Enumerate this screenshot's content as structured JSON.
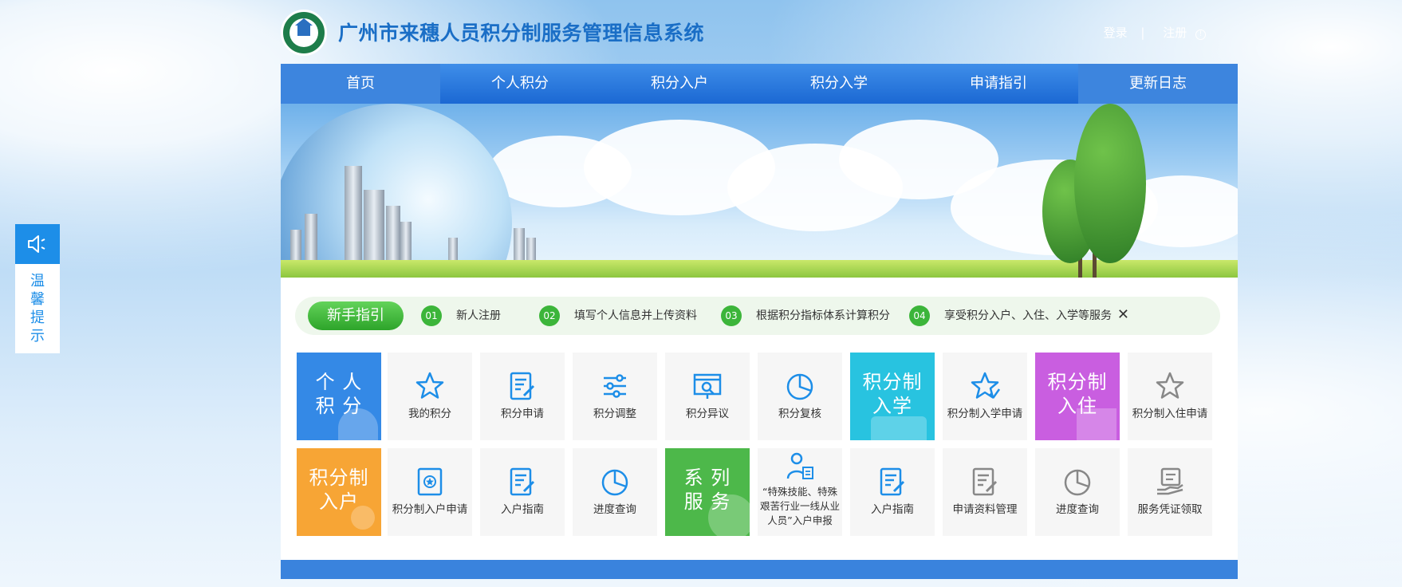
{
  "header": {
    "title": "广州市来穗人员积分制服务管理信息系统",
    "login": "登录",
    "separator": "|",
    "register": "注册",
    "register_icon": "info-circle-icon"
  },
  "nav": {
    "items": [
      "首页",
      "个人积分",
      "积分入户",
      "积分入学",
      "申请指引",
      "更新日志"
    ]
  },
  "guide": {
    "tag": "新手指引",
    "steps": [
      {
        "num": "01",
        "text": "新人注册"
      },
      {
        "num": "02",
        "text": "填写个人信息并上传资料"
      },
      {
        "num": "03",
        "text": "根据积分指标体系计算积分"
      },
      {
        "num": "04",
        "text": "享受积分入户、入住、入学等服务"
      }
    ],
    "close": "✕"
  },
  "row1": {
    "big1": "个 人 积 分",
    "t1": "我的积分",
    "t2": "积分申请",
    "t3": "积分调整",
    "t4": "积分异议",
    "t5": "积分复核",
    "big2": "积分制 入学",
    "t6": "积分制入学申请",
    "big3": "积分制 入住",
    "t7": "积分制入住申请"
  },
  "row2": {
    "big1": "积分制 入户",
    "t1": "积分制入户申请",
    "t2": "入户指南",
    "t3": "进度查询",
    "big2": "系 列 服 务",
    "t4": "“特殊技能、特殊艰苦行业一线从业人员”入户申报",
    "t5": "入户指南",
    "t6": "申请资料管理",
    "t7": "进度查询",
    "t8": "服务凭证领取"
  },
  "side": {
    "text": "温馨提示",
    "icon": "speaker-icon"
  },
  "colors": {
    "brand_blue": "#1a6ec6",
    "nav_blue": "#1b68d3",
    "green": "#3cb53a",
    "tile_blue": "#3489e6",
    "tile_cyan": "#28c3e0",
    "tile_purple": "#c95ee0",
    "tile_orange": "#f7a535",
    "tile_green": "#4db84a"
  }
}
